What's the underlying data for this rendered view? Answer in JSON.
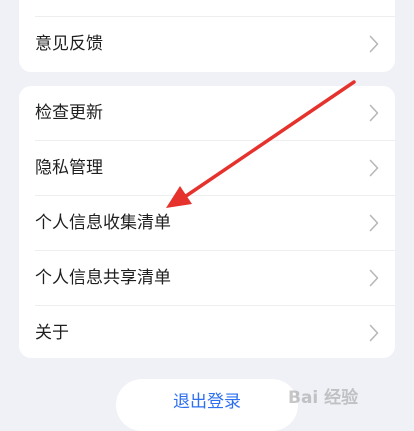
{
  "top_section": {
    "items": [
      {
        "label": "意见反馈"
      }
    ]
  },
  "main_section": {
    "items": [
      {
        "label": "检查更新"
      },
      {
        "label": "隐私管理"
      },
      {
        "label": "个人信息收集清单"
      },
      {
        "label": "个人信息共享清单"
      },
      {
        "label": "关于"
      }
    ]
  },
  "logout": {
    "label": "退出登录"
  },
  "watermark": {
    "text": "Bai 经验"
  },
  "colors": {
    "background": "#eff1f6",
    "card": "#ffffff",
    "accent": "#2d6ff0",
    "annotation_arrow": "#e5322d"
  },
  "icons": {
    "row_chevron": "chevron-right-icon",
    "annotation": "red-arrow-icon"
  }
}
